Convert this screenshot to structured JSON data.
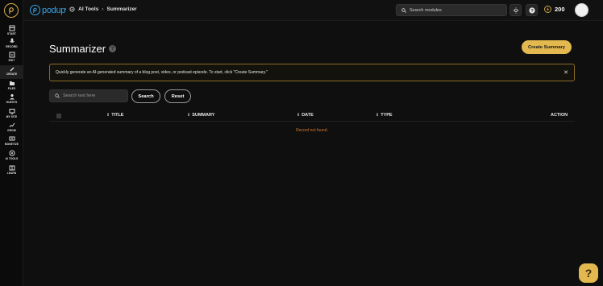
{
  "brand": {
    "name": "podup"
  },
  "breadcrumb": {
    "section": "AI Tools",
    "page": "Summarizer"
  },
  "topbar": {
    "search_placeholder": "Search modules",
    "credits": "200"
  },
  "sidebar": {
    "items": [
      {
        "label": "START",
        "icon": "start-icon"
      },
      {
        "label": "RECORD",
        "icon": "microphone-icon"
      },
      {
        "label": "EDIT",
        "icon": "edit-icon"
      },
      {
        "label": "CREATE",
        "icon": "create-icon",
        "active": true
      },
      {
        "label": "FILES",
        "icon": "files-icon"
      },
      {
        "label": "GUESTS",
        "icon": "guests-icon"
      },
      {
        "label": "MY SITE",
        "icon": "site-icon"
      },
      {
        "label": "GROW",
        "icon": "grow-icon"
      },
      {
        "label": "MONETIZE",
        "icon": "monetize-icon"
      },
      {
        "label": "AI TOOLS",
        "icon": "ai-tools-icon"
      },
      {
        "label": "LEARN",
        "icon": "learn-icon"
      }
    ]
  },
  "page": {
    "title": "Summarizer",
    "create_button": "Create Summary",
    "info": "Quickly generate an AI-generated summary of a blog post, video, or podcast episode. To start, click \"Create Summary.\"",
    "search_placeholder": "Search text here",
    "search_button": "Search",
    "reset_button": "Reset"
  },
  "table": {
    "columns": [
      "TITLE",
      "SUMMARY",
      "DATE",
      "TYPE",
      "ACTION"
    ],
    "empty_message": "Record not found."
  },
  "colors": {
    "accent": "#e2b84f",
    "brand": "#37a3e6",
    "empty": "#d5782a"
  }
}
